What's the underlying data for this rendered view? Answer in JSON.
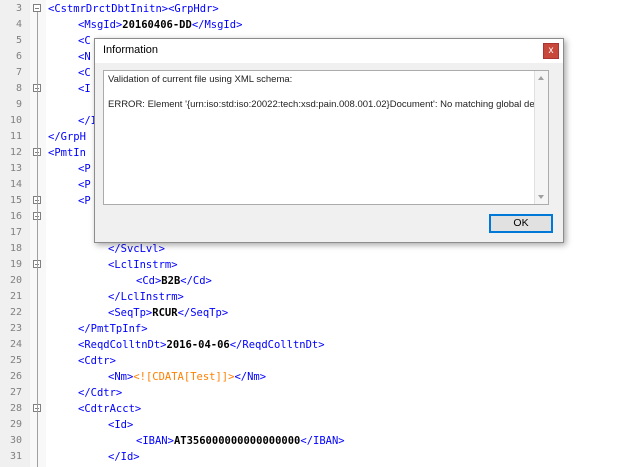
{
  "editor": {
    "lines": [
      {
        "num": "3",
        "segments": [
          {
            "t": "tag",
            "v": "<CstmrDrctDbtInitn><GrpHdr>"
          }
        ]
      },
      {
        "num": "4",
        "segments": [
          {
            "t": "tag",
            "v": "<MsgId>"
          },
          {
            "t": "txt",
            "v": "20160406-DD"
          },
          {
            "t": "tag",
            "v": "</MsgId>"
          }
        ]
      },
      {
        "num": "5",
        "segments": [
          {
            "t": "tag",
            "v": "<C"
          }
        ]
      },
      {
        "num": "6",
        "segments": [
          {
            "t": "tag",
            "v": "<N"
          }
        ]
      },
      {
        "num": "7",
        "segments": [
          {
            "t": "tag",
            "v": "<C"
          }
        ]
      },
      {
        "num": "8",
        "segments": [
          {
            "t": "tag",
            "v": "<I"
          }
        ]
      },
      {
        "num": "9",
        "segments": []
      },
      {
        "num": "10",
        "segments": [
          {
            "t": "tag",
            "v": "</I"
          }
        ]
      },
      {
        "num": "11",
        "segments": [
          {
            "t": "tag",
            "v": "</GrpH"
          }
        ]
      },
      {
        "num": "12",
        "segments": [
          {
            "t": "tag",
            "v": "<PmtIn"
          }
        ]
      },
      {
        "num": "13",
        "segments": [
          {
            "t": "tag",
            "v": "<P"
          }
        ]
      },
      {
        "num": "14",
        "segments": [
          {
            "t": "tag",
            "v": "<P"
          }
        ]
      },
      {
        "num": "15",
        "segments": [
          {
            "t": "tag",
            "v": "<P"
          }
        ]
      },
      {
        "num": "16",
        "segments": []
      },
      {
        "num": "17",
        "segments": []
      },
      {
        "num": "18",
        "segments": [
          {
            "t": "tag",
            "v": "</SvcLvl>"
          }
        ]
      },
      {
        "num": "19",
        "segments": [
          {
            "t": "tag",
            "v": "<LclInstrm>"
          }
        ]
      },
      {
        "num": "20",
        "segments": [
          {
            "t": "tag",
            "v": "<Cd>"
          },
          {
            "t": "txt",
            "v": "B2B"
          },
          {
            "t": "tag",
            "v": "</Cd>"
          }
        ]
      },
      {
        "num": "21",
        "segments": [
          {
            "t": "tag",
            "v": "</LclInstrm>"
          }
        ]
      },
      {
        "num": "22",
        "segments": [
          {
            "t": "tag",
            "v": "<SeqTp>"
          },
          {
            "t": "txt",
            "v": "RCUR"
          },
          {
            "t": "tag",
            "v": "</SeqTp>"
          }
        ]
      },
      {
        "num": "23",
        "segments": [
          {
            "t": "tag",
            "v": "</PmtTpInf>"
          }
        ]
      },
      {
        "num": "24",
        "segments": [
          {
            "t": "tag",
            "v": "<ReqdColltnDt>"
          },
          {
            "t": "txt",
            "v": "2016-04-06"
          },
          {
            "t": "tag",
            "v": "</ReqdColltnDt>"
          }
        ]
      },
      {
        "num": "25",
        "segments": [
          {
            "t": "tag",
            "v": "<Cdtr>"
          }
        ]
      },
      {
        "num": "26",
        "segments": [
          {
            "t": "tag",
            "v": "<Nm>"
          },
          {
            "t": "cdata",
            "v": "<![CDATA[Test]]>"
          },
          {
            "t": "tag",
            "v": "</Nm>"
          }
        ]
      },
      {
        "num": "27",
        "segments": [
          {
            "t": "tag",
            "v": "</Cdtr>"
          }
        ]
      },
      {
        "num": "28",
        "segments": [
          {
            "t": "tag",
            "v": "<CdtrAcct>"
          }
        ]
      },
      {
        "num": "29",
        "segments": [
          {
            "t": "tag",
            "v": "<Id>"
          }
        ]
      },
      {
        "num": "30",
        "segments": [
          {
            "t": "tag",
            "v": "<IBAN>"
          },
          {
            "t": "txt",
            "v": "AT356000000000000000"
          },
          {
            "t": "tag",
            "v": "</IBAN>"
          }
        ]
      },
      {
        "num": "31",
        "segments": [
          {
            "t": "tag",
            "v": "</Id>"
          }
        ]
      }
    ]
  },
  "dialog": {
    "title": "Information",
    "close_label": "x",
    "message_line1": "Validation of current file using XML schema:",
    "message_line2": "ERROR: Element '{urn:iso:std:iso:20022:tech:xsd:pain.008.001.02}Document': No matching global de",
    "ok_label": "OK"
  },
  "colors": {
    "tag": "#0000ff",
    "text": "#000000",
    "cdata": "#ff8000",
    "close_button": "#c9483c",
    "ok_border": "#0078d7"
  }
}
